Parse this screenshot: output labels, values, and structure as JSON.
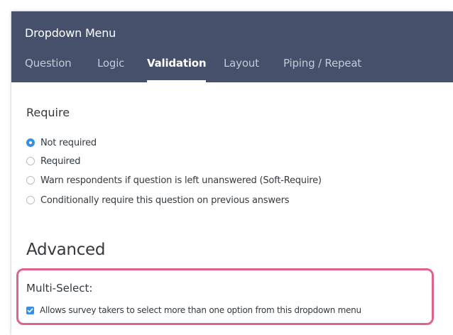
{
  "header": {
    "title": "Dropdown Menu",
    "background_color": "#46506a",
    "tabs": [
      {
        "label": "Question",
        "active": false
      },
      {
        "label": "Logic",
        "active": false
      },
      {
        "label": "Validation",
        "active": true
      },
      {
        "label": "Layout",
        "active": false
      },
      {
        "label": "Piping / Repeat",
        "active": false
      }
    ]
  },
  "require": {
    "heading": "Require",
    "options": [
      {
        "label": "Not required",
        "checked": true
      },
      {
        "label": "Required",
        "checked": false
      },
      {
        "label": "Warn respondents if question is left unanswered (Soft-Require)",
        "checked": false
      },
      {
        "label": "Conditionally require this question on previous answers",
        "checked": false
      }
    ]
  },
  "advanced": {
    "heading": "Advanced",
    "highlight_color": "#e0648a",
    "multi_select": {
      "label": "Multi-Select:",
      "checkbox_label": "Allows survey takers to select more than one option from this dropdown menu",
      "checked": true
    }
  },
  "accent_color": "#3a8fe0",
  "icons": {
    "radio_checked": "radio-checked-icon",
    "radio_unchecked": "radio-unchecked-icon",
    "checkbox_checked": "checkbox-checked-icon"
  }
}
